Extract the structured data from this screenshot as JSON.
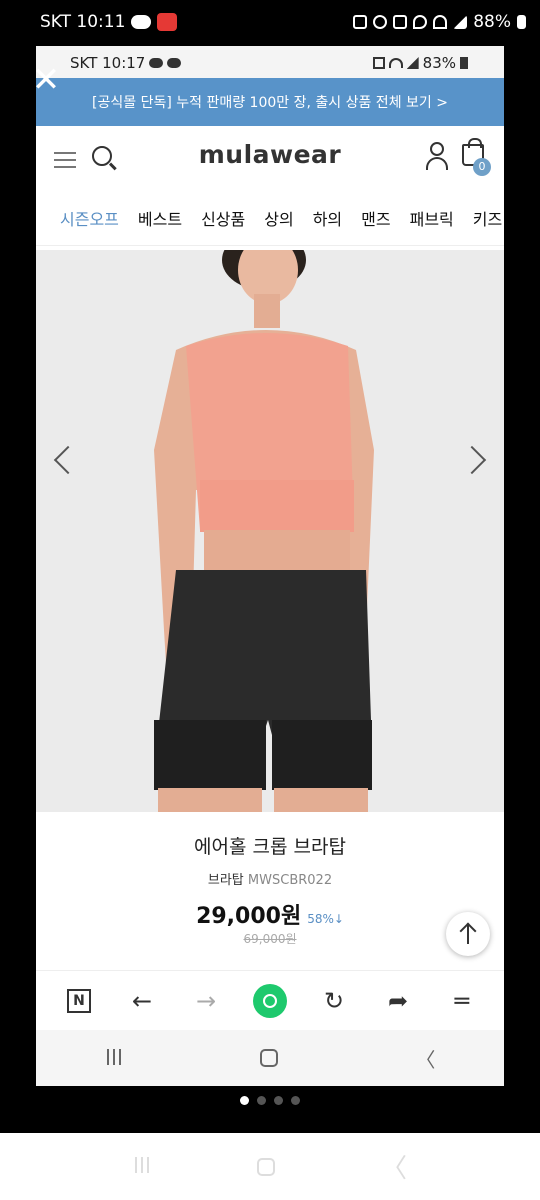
{
  "outer_status": {
    "carrier_time": "SKT 10:11",
    "battery": "88%"
  },
  "inner_status": {
    "carrier_time": "SKT 10:17",
    "battery": "83%"
  },
  "promo_banner": "[공식몰 단독] 누적 판매량 100만 장, 출시 상품 전체 보기 >",
  "header": {
    "logo": "mulawear",
    "cart_count": "0"
  },
  "categories": [
    "시즌오프",
    "베스트",
    "신상품",
    "상의",
    "하의",
    "맨즈",
    "패브릭",
    "키즈"
  ],
  "product": {
    "title": "에어홀 크롭 브라탑",
    "category": "브라탑",
    "code": "MWSCBR022",
    "price": "29,000원",
    "discount": "58%↓",
    "original_price": "69,000원"
  },
  "icons": {
    "close": "close-icon",
    "menu": "menu-icon",
    "search": "search-icon",
    "user": "user-icon",
    "cart": "cart-icon",
    "scroll_top": "arrow-up-icon",
    "naver": "naver-icon",
    "back": "back-arrow-icon",
    "forward": "forward-arrow-icon",
    "green_dot": "green-dot-icon",
    "refresh": "refresh-icon",
    "share": "share-icon",
    "menu_more": "hamburger-icon"
  },
  "toolbar": {
    "naver_label": "N"
  },
  "colors": {
    "promo_bg": "#5893c9",
    "accent": "#5a8fc4",
    "green": "#1ec96d"
  }
}
